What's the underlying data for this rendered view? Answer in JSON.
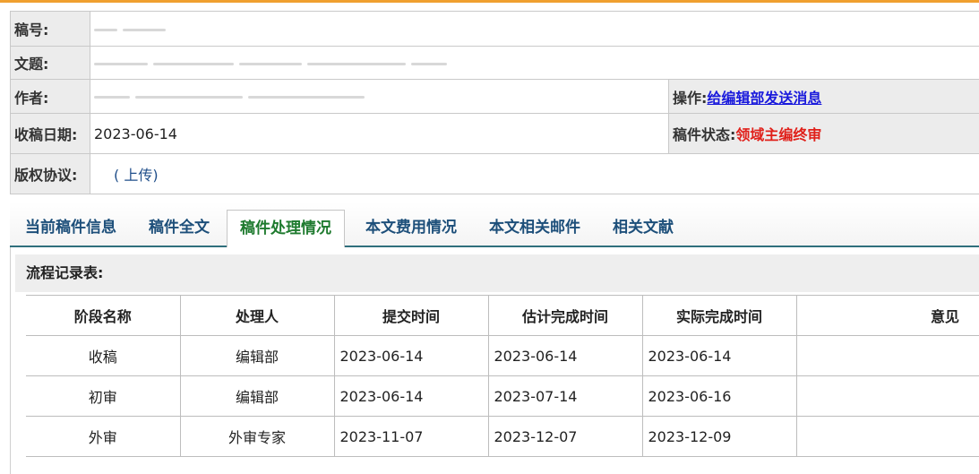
{
  "info": {
    "manuscript_no_label": "稿号:",
    "title_label": "文题:",
    "author_label": "作者:",
    "operation_label": "操作:",
    "operation_link": "给编辑部发送消息",
    "received_date_label": "收稿日期:",
    "received_date": "2023-06-14",
    "status_label": "稿件状态:",
    "status_value": "领域主编终审",
    "copyright_label": "版权协议:",
    "copyright_upload": "( 上传)"
  },
  "tabs": [
    {
      "label": "当前稿件信息"
    },
    {
      "label": "稿件全文"
    },
    {
      "label": "稿件处理情况"
    },
    {
      "label": "本文费用情况"
    },
    {
      "label": "本文相关邮件"
    },
    {
      "label": "相关文献"
    }
  ],
  "process": {
    "heading": "流程记录表:",
    "columns": [
      "阶段名称",
      "处理人",
      "提交时间",
      "估计完成时间",
      "实际完成时间",
      "意见"
    ],
    "rows": [
      [
        "收稿",
        "编辑部",
        "2023-06-14",
        "2023-06-14",
        "2023-06-14",
        ""
      ],
      [
        "初审",
        "编辑部",
        "2023-06-14",
        "2023-07-14",
        "2023-06-16",
        ""
      ],
      [
        "外审",
        "外审专家",
        "2023-11-07",
        "2023-12-07",
        "2023-12-09",
        ""
      ]
    ]
  },
  "colors": {
    "accent_top": "#f0a030",
    "link": "#1a1adc",
    "status_red": "#e0201a",
    "tab_text": "#1d4f7a",
    "tab_active": "#1e7a2e"
  }
}
